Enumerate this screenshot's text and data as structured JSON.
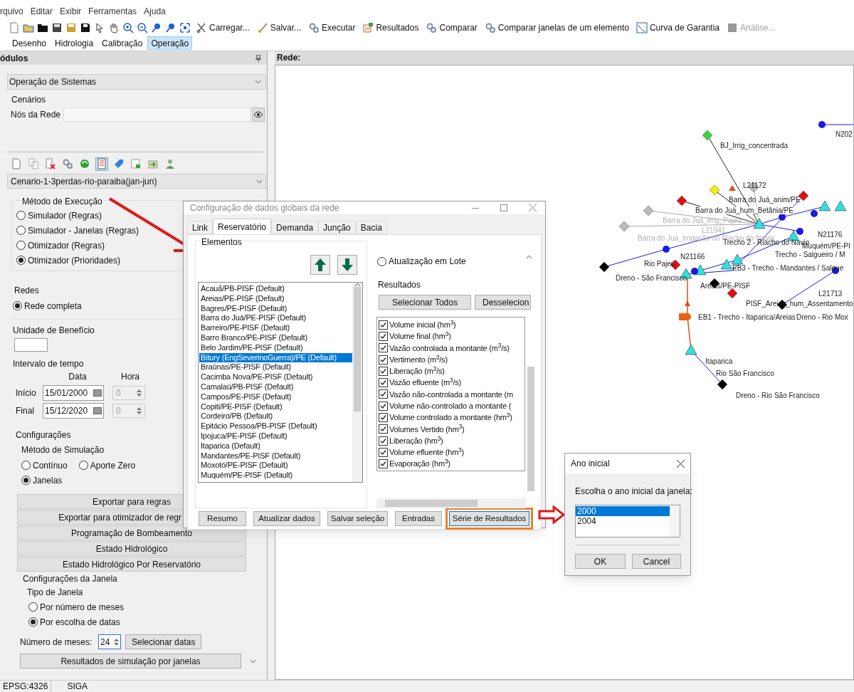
{
  "menu": [
    "rquivo",
    "Editar",
    "Exibir",
    "Ferramentas",
    "Ajuda"
  ],
  "toolbar": {
    "actions": [
      {
        "label": "Carregar...",
        "disabled": false
      },
      {
        "label": "Salvar...",
        "disabled": false
      },
      {
        "label": "Executar",
        "disabled": false
      },
      {
        "label": "Resultados",
        "disabled": false
      },
      {
        "label": "Comparar",
        "disabled": false
      },
      {
        "label": "Comparar janelas de um elemento",
        "disabled": false
      },
      {
        "label": "Curva de Garantia",
        "disabled": false
      },
      {
        "label": "Análise...",
        "disabled": true
      }
    ]
  },
  "ribbon_tabs": [
    {
      "label": "Desenho",
      "selected": false
    },
    {
      "label": "Hidrologia",
      "selected": false
    },
    {
      "label": "Calibração",
      "selected": false
    },
    {
      "label": "Operação",
      "selected": true
    }
  ],
  "modules_panel": {
    "title": "ódulos",
    "module": "Operação de Sistemas",
    "scenarios_label": "Cenários",
    "network_nodes_label": "Nós da Rede",
    "scenario_tools": [
      {
        "selected": false
      },
      {
        "selected": false
      },
      {
        "selected": false
      },
      {
        "selected": false
      },
      {
        "selected": false
      },
      {
        "selected": true
      },
      {
        "selected": false
      },
      {
        "selected": false
      },
      {
        "selected": false
      },
      {
        "selected": false
      }
    ],
    "scenario": "Cenario-1-3perdas-rio-paraiba(jan-jun)",
    "execution_method": {
      "title": "Método de Execução",
      "options": [
        {
          "label": "Simulador (Regras)",
          "selected": false
        },
        {
          "label": "Simulador - Janelas (Regras)",
          "selected": false
        },
        {
          "label": "Otimizador (Regras)",
          "selected": false
        },
        {
          "label": "Otimizador (Prioridades)",
          "selected": true
        }
      ]
    },
    "networks": {
      "title": "Redes",
      "options": [
        {
          "label": "Rede completa",
          "selected": true
        }
      ]
    },
    "benefit_unit_label": "Unidade de Benefício",
    "time_interval": {
      "title": "Intervalo de tempo",
      "date_header": "Data",
      "hour_header": "Hora",
      "rows": [
        {
          "label": "Início",
          "date": "15/01/2000",
          "hour": "0"
        },
        {
          "label": "Final",
          "date": "15/12/2020",
          "hour": "0"
        }
      ]
    },
    "settings_title": "Configurações",
    "simulation_method": {
      "title": "Método de Simulação",
      "options": [
        {
          "label": "Contínuo",
          "selected": false
        },
        {
          "label": "Aporte Zero",
          "selected": false
        },
        {
          "label": "Janelas",
          "selected": true
        }
      ]
    },
    "buttons": [
      "Exportar para regras",
      "Exportar para otimizador de regr",
      "Programação de Bombeamento",
      "Estado Hidrológico",
      "Estado Hidrológico Por Reservatório"
    ],
    "window_settings": {
      "title": "Configurações da Janela",
      "type_title": "Tipo de Janela",
      "options": [
        {
          "label": "Por número de meses",
          "selected": false
        },
        {
          "label": "Por escolha de datas",
          "selected": true
        }
      ],
      "months_label": "Número de meses:",
      "months_value": "24",
      "select_dates": "Selecionar datas"
    },
    "results_button": "Resultados de simulação por janelas"
  },
  "network_panel": {
    "title": "Rede:",
    "labels": [
      {
        "text": "N202",
        "faded": false
      },
      {
        "text": "BJ_Irrig_concentrada",
        "faded": false
      },
      {
        "text": "L21172",
        "faded": false
      },
      {
        "text": "Barra do Juá_anim/PE",
        "faded": false
      },
      {
        "text": "Barra do Juá_hum_Betânia/PE",
        "faded": false
      },
      {
        "text": "Barra do Juá_irrig_Pajeú",
        "faded": true
      },
      {
        "text": "L21941",
        "faded": true
      },
      {
        "text": "Barra do Juá_Irrigação no Riacho do Navio",
        "faded": true
      },
      {
        "text": "Trecho 2 - Riacho do Navio",
        "faded": false
      },
      {
        "text": "N21176",
        "faded": false
      },
      {
        "text": "Muquém/PE-PI",
        "faded": false
      },
      {
        "text": "Trecho - Salgueiro / M",
        "faded": false
      },
      {
        "text": "Rio Pajeú",
        "faded": false
      },
      {
        "text": "N21166",
        "faded": false
      },
      {
        "text": "EB3 - Trecho - Mandantes / Salgue",
        "faded": false
      },
      {
        "text": "Dreno - São Francisco",
        "faded": false
      },
      {
        "text": "Areias/PE-PISF",
        "faded": false
      },
      {
        "text": "L21713",
        "faded": false
      },
      {
        "text": "PISF_Areias_hum_Assentamento",
        "faded": false
      },
      {
        "text": "EB1 - Trecho - Itaparica/Areias",
        "faded": false
      },
      {
        "text": "Dreno - Rio Mox",
        "faded": false
      },
      {
        "text": "Itaparica",
        "faded": false
      },
      {
        "text": "Rio São Francisco",
        "faded": false
      },
      {
        "text": "Dreno - Rio São Francisco",
        "faded": false
      }
    ]
  },
  "config_dialog": {
    "title": "Configuração de dados globais da rede",
    "tabs": [
      {
        "label": "Link",
        "selected": false
      },
      {
        "label": "Reservatório",
        "selected": true
      },
      {
        "label": "Demanda",
        "selected": false
      },
      {
        "label": "Junção",
        "selected": false
      },
      {
        "label": "Bacia",
        "selected": false
      }
    ],
    "elements_title": "Elementos",
    "elements": [
      {
        "label": "Acauã/PB-PISF (Default)",
        "selected": false
      },
      {
        "label": "Areias/PE-PISF (Default)",
        "selected": false
      },
      {
        "label": "Bagres/PE-PISF (Default)",
        "selected": false
      },
      {
        "label": "Barra do Juá/PE-PISF (Default)",
        "selected": false
      },
      {
        "label": "Barreiro/PE-PISF (Default)",
        "selected": false
      },
      {
        "label": "Barro Branco/PE-PISF (Default)",
        "selected": false
      },
      {
        "label": "Belo Jardim/PE-PISF (Default)",
        "selected": false
      },
      {
        "label": "Bitury (EngSeverinoGuerra)/PE (Default)",
        "selected": true
      },
      {
        "label": "Braúnas/PE-PISF (Default)",
        "selected": false
      },
      {
        "label": "Cacimba Nova/PE-PISF (Default)",
        "selected": false
      },
      {
        "label": "Camalaú/PB-PISF (Default)",
        "selected": false
      },
      {
        "label": "Campos/PE-PISF (Default)",
        "selected": false
      },
      {
        "label": "Copiti/PE-PISF (Default)",
        "selected": false
      },
      {
        "label": "Cordeiro/PB (Default)",
        "selected": false
      },
      {
        "label": "Epitácio Pessoa/PB-PISF (Default)",
        "selected": false
      },
      {
        "label": "Ipojuca/PE-PISF (Default)",
        "selected": false
      },
      {
        "label": "Itaparica (Default)",
        "selected": false
      },
      {
        "label": "Mandantes/PE-PISF (Default)",
        "selected": false
      },
      {
        "label": "Moxotó/PE-PISF (Default)",
        "selected": false
      },
      {
        "label": "Muquém/PE-PISF (Default)",
        "selected": false
      }
    ],
    "update_option": {
      "label": "Atualização em Lote",
      "selected": false
    },
    "results_title": "Resultados",
    "select_all": "Selecionar Todos",
    "deselect": "Desselecion",
    "results": [
      {
        "label": "Volume inicial (hm$^{3}$)",
        "checked": true
      },
      {
        "label": "Volume final (hm$^{3}$)",
        "checked": true
      },
      {
        "label": "Vazão controlada a montante (m$^{3}$/s)",
        "checked": true
      },
      {
        "label": "Vertimento (m$^{3}$/s)",
        "checked": true
      },
      {
        "label": "Liberação (m$^{3}$/s)",
        "checked": true
      },
      {
        "label": "Vazão efluente (m$^{3}$/s)",
        "checked": true
      },
      {
        "label": "Vazão não-controlada a montante (m",
        "checked": true
      },
      {
        "label": "Volume não-controlado a montante (",
        "checked": true
      },
      {
        "label": "Volume controlado a montante (hm$^{3}$)",
        "checked": true
      },
      {
        "label": "Volumes Vertido (hm$^{3}$)",
        "checked": true
      },
      {
        "label": "Liberação (hm$^{3}$)",
        "checked": true
      },
      {
        "label": "Volume efluente (hm$^{3}$)",
        "checked": true
      },
      {
        "label": "Evaporação (hm$^{3}$)",
        "checked": true
      }
    ],
    "buttons": [
      {
        "label": "Resumo",
        "highlighted": false
      },
      {
        "label": "Atualizar dados",
        "highlighted": false
      },
      {
        "label": "Salvar seleção",
        "highlighted": false
      },
      {
        "label": "Entradas",
        "highlighted": false
      },
      {
        "label": "Série de Resultados",
        "highlighted": true
      }
    ]
  },
  "year_dialog": {
    "title": "Ano inicial",
    "prompt": "Escolha o ano inicial da janela:",
    "years": [
      {
        "label": "2000",
        "selected": true
      },
      {
        "label": "2004",
        "selected": false
      }
    ],
    "ok": "OK",
    "cancel": "Cancel"
  },
  "status_bar": [
    "EPSG:4326",
    "SIGA"
  ]
}
